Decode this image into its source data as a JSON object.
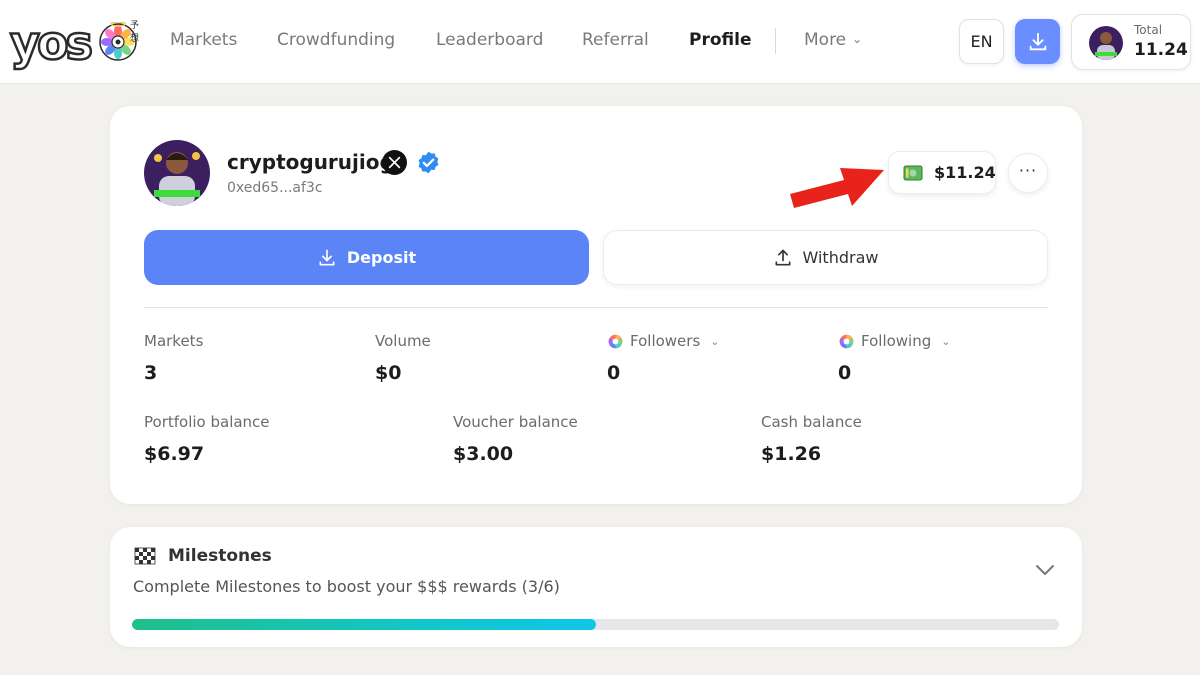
{
  "header": {
    "logo_text": "yos",
    "logo_sup": "予想",
    "nav": [
      {
        "label": "Markets",
        "active": false
      },
      {
        "label": "Crowdfunding",
        "active": false
      },
      {
        "label": "Leaderboard",
        "active": false
      },
      {
        "label": "Referral",
        "active": false
      },
      {
        "label": "Profile",
        "active": true
      },
      {
        "label": "More",
        "active": false
      }
    ],
    "lang": "EN",
    "total": {
      "label": "Total",
      "value": "11.24"
    }
  },
  "profile": {
    "username": "cryptogurujiog",
    "address": "0xed65...af3c",
    "balance_chip": "$11.24",
    "more_label": "···",
    "deposit_label": "Deposit",
    "withdraw_label": "Withdraw",
    "stats_row1": [
      {
        "label": "Markets",
        "value": "3"
      },
      {
        "label": "Volume",
        "value": "$0"
      },
      {
        "label": "Followers",
        "value": "0"
      },
      {
        "label": "Following",
        "value": "0"
      }
    ],
    "stats_row2": [
      {
        "label": "Portfolio balance",
        "value": "$6.97"
      },
      {
        "label": "Voucher balance",
        "value": "$3.00"
      },
      {
        "label": "Cash balance",
        "value": "$1.26"
      }
    ]
  },
  "milestones": {
    "title": "Milestones",
    "description": "Complete Milestones to boost your $$$ rewards (3/6)",
    "progress_fraction": 0.5
  },
  "colors": {
    "accent": "#5b85f7",
    "annotation_arrow": "#e8231c",
    "progress_start": "#1fbf8a",
    "progress_end": "#0fc6ea"
  }
}
